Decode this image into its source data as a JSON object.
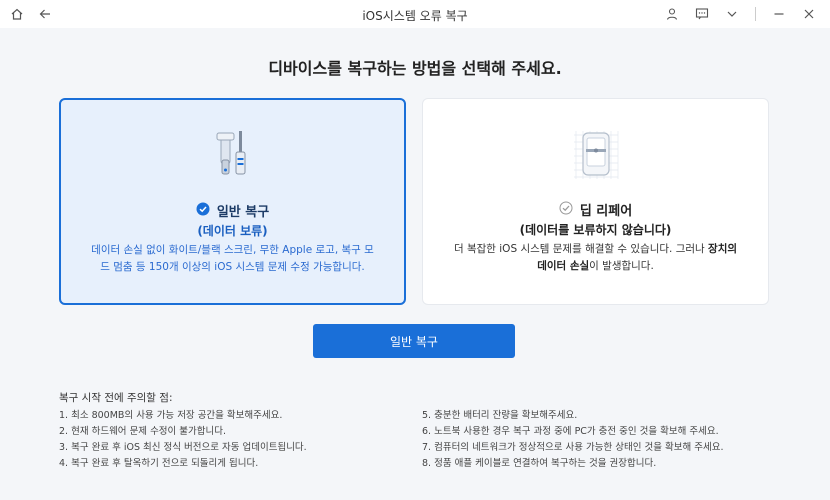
{
  "window": {
    "title": "iOS시스템 오류 복구"
  },
  "heading": "디바이스를 복구하는 방법을 선택해 주세요.",
  "cards": [
    {
      "title": "일반 복구",
      "subtitle": "(데이터 보류)",
      "desc_line1": "데이터 손실 없이 화이트/블랙 스크린, 무한 Apple 로고, 복구 모",
      "desc_line2": "드 멈춤 등 150개 이상의 iOS 시스템 문제  수정 가능합니다.",
      "selected": true
    },
    {
      "title": "딥 리페어",
      "subtitle": "(데이터를 보류하지 않습니다)",
      "desc_a": "더 복잡한 iOS 시스템 문제를 해결할 수 있습니다. 그러나 ",
      "desc_b": "장치의",
      "desc_c": "데이터 손실",
      "desc_d": "이 발생합니다.",
      "selected": false
    }
  ],
  "primary_button": "일반 복구",
  "notes": {
    "title": "복구 시작 전에 주의할 점:",
    "col1": [
      "1.  최소 800MB의 사용 가능 저장 공간을 확보해주세요.",
      "2.  현재 하드웨어 문제 수정이 불가합니다.",
      "3.  복구 완료 후 iOS 최신 정식 버전으로 자동 업데이트됩니다.",
      "4.  복구 완료 후 탈옥하기 전으로 되돌리게 됩니다."
    ],
    "col2": [
      "5.  충분한 배터리 잔량을 확보해주세요.",
      "6.  노트북 사용한 경우 복구 과정 중에 PC가 충전 중인 것을 확보해 주세요.",
      "7.  컴퓨터의 네트워크가 정상적으로 사용 가능한 상태인 것을 확보해 주세요.",
      "8.  정품 애플 케이블로 연결하여 복구하는 것을 권장합니다."
    ]
  },
  "colors": {
    "accent": "#1a6fd8",
    "selected_bg": "#e7f0fc",
    "background": "#f4f6f9"
  },
  "icons": [
    "home-icon",
    "back-arrow-icon",
    "user-icon",
    "feedback-icon",
    "chevron-down-icon",
    "minimize-icon",
    "close-icon",
    "check-circle-icon",
    "tools-icon",
    "phone-icon"
  ]
}
